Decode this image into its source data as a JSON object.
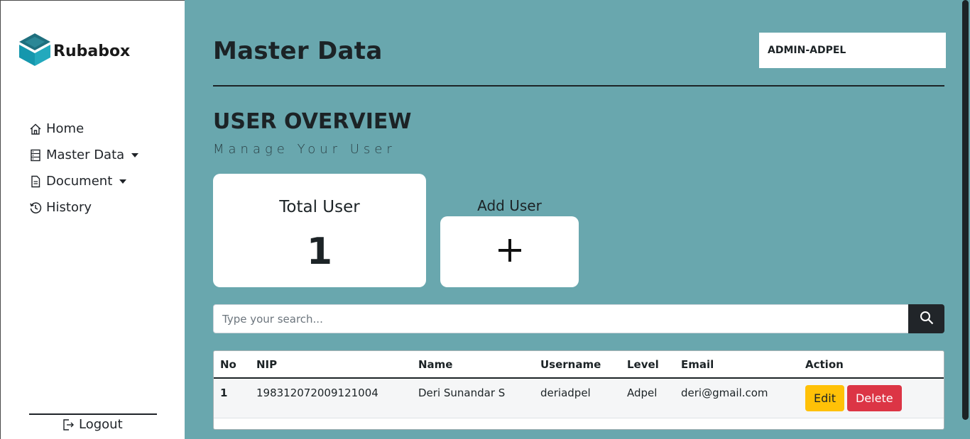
{
  "brand": {
    "name": "Rubabox"
  },
  "sidebar": {
    "items": [
      {
        "label": "Home",
        "icon": "home-icon"
      },
      {
        "label": "Master Data",
        "icon": "server-icon"
      },
      {
        "label": "Document",
        "icon": "document-icon"
      },
      {
        "label": "History",
        "icon": "history-icon"
      }
    ],
    "logout_label": "Logout"
  },
  "header": {
    "title": "Master Data",
    "user": "ADMIN-ADPEL"
  },
  "overview": {
    "title": "USER OVERVIEW",
    "subtitle": "Manage Your User",
    "total_label": "Total User",
    "total_value": "1",
    "add_label": "Add User"
  },
  "search": {
    "placeholder": "Type your search..."
  },
  "table": {
    "columns": [
      "No",
      "NIP",
      "Name",
      "Username",
      "Level",
      "Email",
      "Action"
    ],
    "rows": [
      {
        "no": "1",
        "nip": "198312072009121004",
        "name": "Deri Sunandar S",
        "username": "deriadpel",
        "level": "Adpel",
        "email": "deri@gmail.com",
        "edit": "Edit",
        "delete": "Delete"
      }
    ]
  },
  "colors": {
    "background": "#69a7ae",
    "brand": "#1b8a9b",
    "edit": "#ffc107",
    "delete": "#dc3545"
  }
}
